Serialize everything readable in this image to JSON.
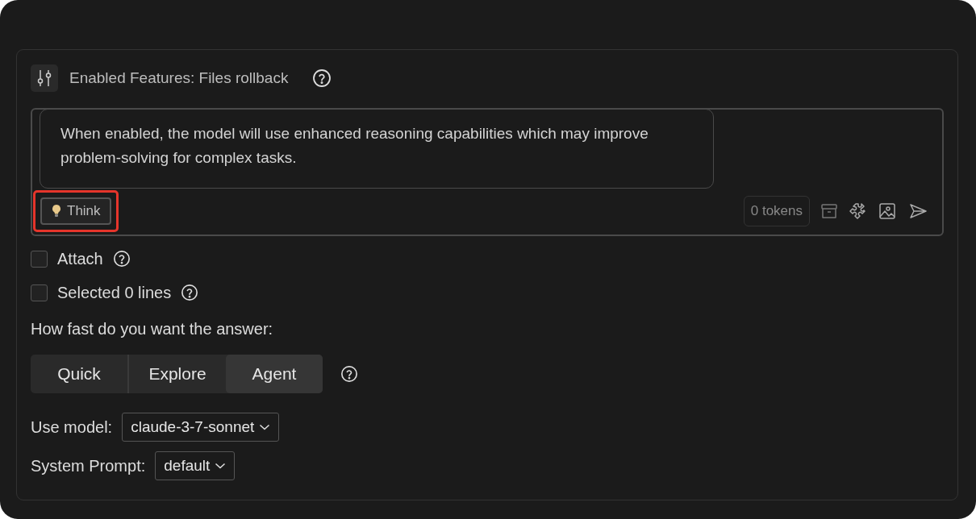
{
  "header": {
    "label": "Enabled Features:",
    "value": "Files rollback"
  },
  "tooltip": {
    "text": "When enabled, the model will use enhanced reasoning capabilities which may improve problem-solving for complex tasks."
  },
  "composer": {
    "think": {
      "label": "Think",
      "highlighted": true
    },
    "tokens": "0 tokens"
  },
  "options": [
    {
      "label": "Attach",
      "checked": false
    },
    {
      "label": "Selected 0 lines",
      "checked": false
    }
  ],
  "speed": {
    "label": "How fast do you want the answer:",
    "modes": [
      {
        "label": "Quick",
        "selected": false
      },
      {
        "label": "Explore",
        "selected": false
      },
      {
        "label": "Agent",
        "selected": true
      }
    ]
  },
  "model": {
    "label": "Use model:",
    "value": "claude-3-7-sonnet"
  },
  "system_prompt": {
    "label": "System Prompt:",
    "value": "default"
  }
}
